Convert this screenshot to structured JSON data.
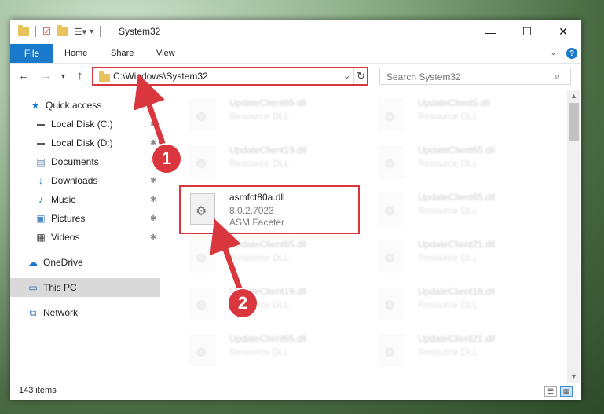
{
  "window": {
    "title": "System32",
    "controls": [
      "—",
      "☐",
      "✕"
    ]
  },
  "ribbon": {
    "file_tab": "File",
    "tabs": [
      "Home",
      "Share",
      "View"
    ],
    "help": "?"
  },
  "address": {
    "path": "C:\\Windows\\System32",
    "search_placeholder": "Search System32"
  },
  "sidebar": {
    "items": [
      {
        "label": "Quick access",
        "icon": "star-icon"
      },
      {
        "label": "Local Disk (C:)",
        "icon": "drive-icon"
      },
      {
        "label": "Local Disk (D:)",
        "icon": "drive-icon"
      },
      {
        "label": "Documents",
        "icon": "documents-icon"
      },
      {
        "label": "Downloads",
        "icon": "downloads-icon"
      },
      {
        "label": "Music",
        "icon": "music-icon"
      },
      {
        "label": "Pictures",
        "icon": "pictures-icon"
      },
      {
        "label": "Videos",
        "icon": "videos-icon"
      },
      {
        "label": "OneDrive",
        "icon": "cloud-icon"
      },
      {
        "label": "This PC",
        "icon": "computer-icon"
      },
      {
        "label": "Network",
        "icon": "network-icon"
      }
    ]
  },
  "files": {
    "left": [
      {
        "name": "UpdateClient65.dll",
        "desc": "Resource DLL"
      },
      {
        "name": "UpdateClient19.dll",
        "desc": "Resource DLL"
      },
      {
        "name": "asmfct80a.dll",
        "version": "8.0.2.7023",
        "desc": "ASM Faceter"
      },
      {
        "name": "UpdateClient65.dll",
        "desc": "Resource DLL"
      },
      {
        "name": "UpdateClient19.dll",
        "desc": "Resource DLL"
      },
      {
        "name": "UpdateClient65.dll",
        "desc": "Resource DLL"
      }
    ],
    "right": [
      {
        "name": "UpdateClient5.dll",
        "desc": "Resource DLL"
      },
      {
        "name": "UpdateClient65.dll",
        "desc": "Resource DLL"
      },
      {
        "name": "UpdateClient65.dll",
        "desc": "Resource DLL"
      },
      {
        "name": "UpdateClient21.dll",
        "desc": "Resource DLL"
      },
      {
        "name": "UpdateClient19.dll",
        "desc": "Resource DLL"
      },
      {
        "name": "UpdateClient21.dll",
        "desc": "Resource DLL"
      }
    ]
  },
  "status": {
    "items_count": "143 items"
  },
  "annotations": {
    "step1": "1",
    "step2": "2"
  },
  "colors": {
    "accent": "#1979ca",
    "highlight": "#d9363e"
  }
}
